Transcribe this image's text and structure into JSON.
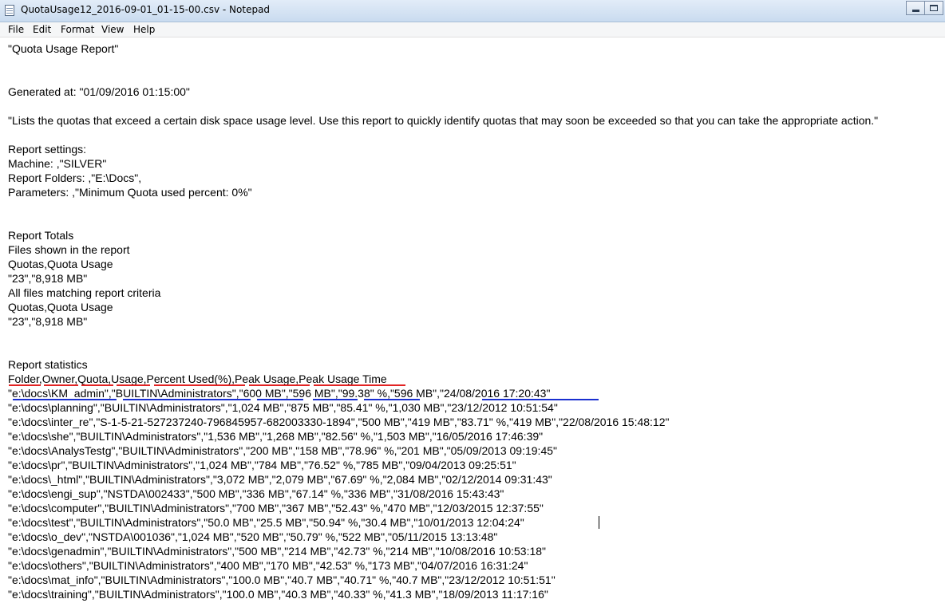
{
  "window": {
    "title": "QuotaUsage12_2016-09-01_01-15-00.csv - Notepad",
    "icons": {
      "app": "notepad-icon",
      "minimize": "minimize-icon",
      "maximize": "maximize-icon"
    }
  },
  "menu": [
    "File",
    "Edit",
    "Format",
    "View",
    "Help"
  ],
  "lines": [
    "\"Quota Usage Report\"",
    "",
    "",
    "Generated at: \"01/09/2016 01:15:00\"",
    "",
    "\"Lists the quotas that exceed a certain disk space usage level. Use this report to quickly identify quotas that may soon be exceeded so that you can take the appropriate action.\"",
    "",
    "Report settings:",
    "Machine: ,\"SILVER\"",
    "Report Folders: ,\"E:\\Docs\",",
    "Parameters: ,\"Minimum Quota used percent: 0%\"",
    "",
    "",
    "Report Totals",
    "Files shown in the report",
    "Quotas,Quota Usage",
    "\"23\",\"8,918 MB\"",
    "All files matching report criteria",
    "Quotas,Quota Usage",
    "\"23\",\"8,918 MB\"",
    "",
    "",
    "Report statistics",
    "Folder,Owner,Quota,Usage,Percent Used(%),Peak Usage,Peak Usage Time",
    "\"e:\\docs\\KM_admin\",\"BUILTIN\\Administrators\",\"600 MB\",\"596 MB\",\"99.38\" %,\"596 MB\",\"24/08/2016 17:20:43\"",
    "\"e:\\docs\\planning\",\"BUILTIN\\Administrators\",\"1,024 MB\",\"875 MB\",\"85.41\" %,\"1,030 MB\",\"23/12/2012 10:51:54\"",
    "\"e:\\docs\\inter_re\",\"S-1-5-21-527237240-796845957-682003330-1894\",\"500 MB\",\"419 MB\",\"83.71\" %,\"419 MB\",\"22/08/2016 15:48:12\"",
    "\"e:\\docs\\she\",\"BUILTIN\\Administrators\",\"1,536 MB\",\"1,268 MB\",\"82.56\" %,\"1,503 MB\",\"16/05/2016 17:46:39\"",
    "\"e:\\docs\\AnalysTestg\",\"BUILTIN\\Administrators\",\"200 MB\",\"158 MB\",\"78.96\" %,\"201 MB\",\"05/09/2013 09:19:45\"",
    "\"e:\\docs\\pr\",\"BUILTIN\\Administrators\",\"1,024 MB\",\"784 MB\",\"76.52\" %,\"785 MB\",\"09/04/2013 09:25:51\"",
    "\"e:\\docs\\_html\",\"BUILTIN\\Administrators\",\"3,072 MB\",\"2,079 MB\",\"67.69\" %,\"2,084 MB\",\"02/12/2014 09:31:43\"",
    "\"e:\\docs\\engi_sup\",\"NSTDA\\002433\",\"500 MB\",\"336 MB\",\"67.14\" %,\"336 MB\",\"31/08/2016 15:43:43\"",
    "\"e:\\docs\\computer\",\"BUILTIN\\Administrators\",\"700 MB\",\"367 MB\",\"52.43\" %,\"470 MB\",\"12/03/2015 12:37:55\"",
    "\"e:\\docs\\test\",\"BUILTIN\\Administrators\",\"50.0 MB\",\"25.5 MB\",\"50.94\" %,\"30.4 MB\",\"10/01/2013 12:04:24\"",
    "\"e:\\docs\\o_dev\",\"NSTDA\\001036\",\"1,024 MB\",\"520 MB\",\"50.79\" %,\"522 MB\",\"05/11/2015 13:13:48\"",
    "\"e:\\docs\\genadmin\",\"BUILTIN\\Administrators\",\"500 MB\",\"214 MB\",\"42.73\" %,\"214 MB\",\"10/08/2016 10:53:18\"",
    "\"e:\\docs\\others\",\"BUILTIN\\Administrators\",\"400 MB\",\"170 MB\",\"42.53\" %,\"173 MB\",\"04/07/2016 16:31:24\"",
    "\"e:\\docs\\mat_info\",\"BUILTIN\\Administrators\",\"100.0 MB\",\"40.7 MB\",\"40.71\" %,\"40.7 MB\",\"23/12/2012 10:51:51\"",
    "\"e:\\docs\\training\",\"BUILTIN\\Administrators\",\"100.0 MB\",\"40.3 MB\",\"40.33\" %,\"41.3 MB\",\"18/09/2013 11:17:16\""
  ],
  "annotation_colors": {
    "header_underline": "#e22323",
    "row_underline": "#1a2fd0"
  }
}
